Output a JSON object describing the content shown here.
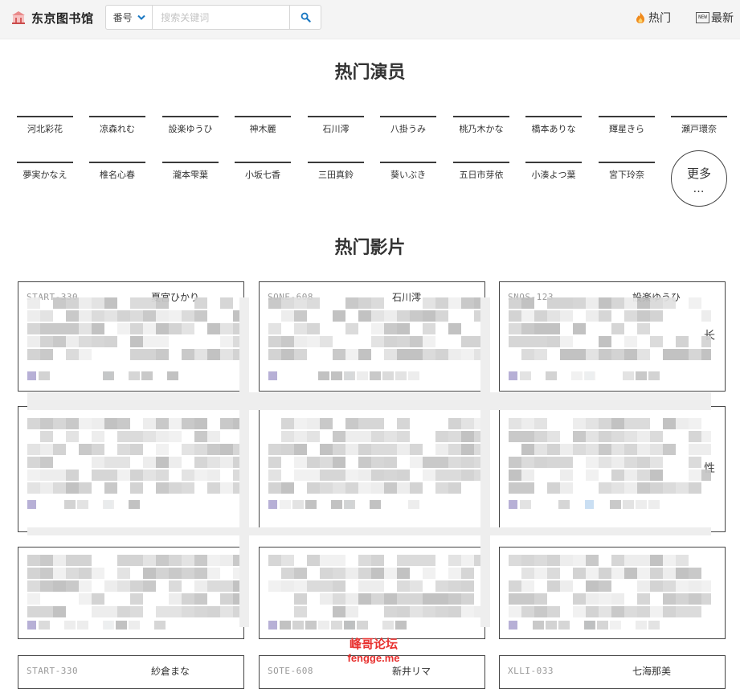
{
  "header": {
    "site_name": "东京图书馆",
    "search": {
      "type_label": "番号",
      "placeholder": "搜索关键词"
    },
    "nav": {
      "hot": "热门",
      "newest": "最新",
      "new_badge": "NEW"
    }
  },
  "actors_section": {
    "title": "热门演员",
    "actors": [
      "河北彩花",
      "凉森れむ",
      "設楽ゆうひ",
      "神木麗",
      "石川澪",
      "八掛うみ",
      "桃乃木かな",
      "橋本ありな",
      "輝星きら",
      "瀬戸環奈",
      "夢実かなえ",
      "椎名心春",
      "瀧本雫葉",
      "小坂七香",
      "三田真鈴",
      "葵いぶき",
      "五日市芽依",
      "小湊よつ葉",
      "宮下玲奈"
    ],
    "more": "更多",
    "more_dots": "…"
  },
  "movies_section": {
    "title": "热门影片",
    "cards": [
      {
        "code": "START-330",
        "actress": "夏宮ひかり",
        "edge": ""
      },
      {
        "code": "SONE-608",
        "actress": "石川澪",
        "edge": ""
      },
      {
        "code": "SNOS-123",
        "actress": "設楽ゆうひ",
        "edge": "长"
      },
      {
        "code": "",
        "actress": "",
        "edge": ""
      },
      {
        "code": "",
        "actress": "",
        "edge": ""
      },
      {
        "code": "",
        "actress": "",
        "edge": "性"
      },
      {
        "code": "",
        "actress": "",
        "edge": ""
      },
      {
        "code": "",
        "actress": "",
        "edge": ""
      },
      {
        "code": "",
        "actress": "",
        "edge": ""
      },
      {
        "code": "START-330",
        "actress": "紗倉まな",
        "edge": ""
      },
      {
        "code": "SOTE-608",
        "actress": "新井リマ",
        "edge": ""
      },
      {
        "code": "XLLI-033",
        "actress": "七海那美",
        "edge": ""
      }
    ]
  },
  "watermark": {
    "line1": "峰哥论坛",
    "line2": "fengge.me"
  },
  "colors": {
    "accent": "#1a78c2",
    "flame": "#f08a1c",
    "watermark": "#e8312f",
    "mosaic_purple": "#b1a9d2",
    "mosaic_blue": "#c6dcf2"
  }
}
